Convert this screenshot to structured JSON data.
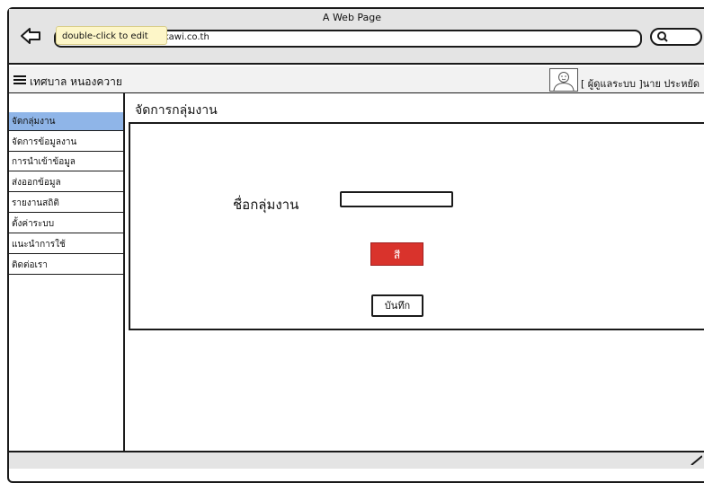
{
  "window": {
    "title": "A Web Page"
  },
  "browser": {
    "url": "://www.nongkawi.co.th",
    "tooltip": "double-click to edit"
  },
  "nav": {
    "app_title": "เทศบาล  หนองควาย",
    "user_label": "[ ผู้ดูแลระบบ ]นาย ประหยัด"
  },
  "sidebar": {
    "items": [
      {
        "label": "จัดกลุ่มงาน",
        "active": true
      },
      {
        "label": "จัดการข้อมูลงาน"
      },
      {
        "label": "การนำเข้าข้อมูล"
      },
      {
        "label": "ส่งออกข้อมูล"
      },
      {
        "label": "รายงานสถิติ"
      },
      {
        "label": "ตั้งค่าระบบ"
      },
      {
        "label": "แนะนำการใช้"
      },
      {
        "label": "ติดต่อเรา"
      }
    ]
  },
  "main": {
    "title": "จัดการกลุ่มงาน",
    "field_label": "ชื่อกลุ่มงาน",
    "group_name_value": "",
    "color_button_label": "สี",
    "save_button_label": "บันทึก"
  },
  "colors": {
    "active_item": "#8fb5e8",
    "color_button": "#d9332c"
  }
}
